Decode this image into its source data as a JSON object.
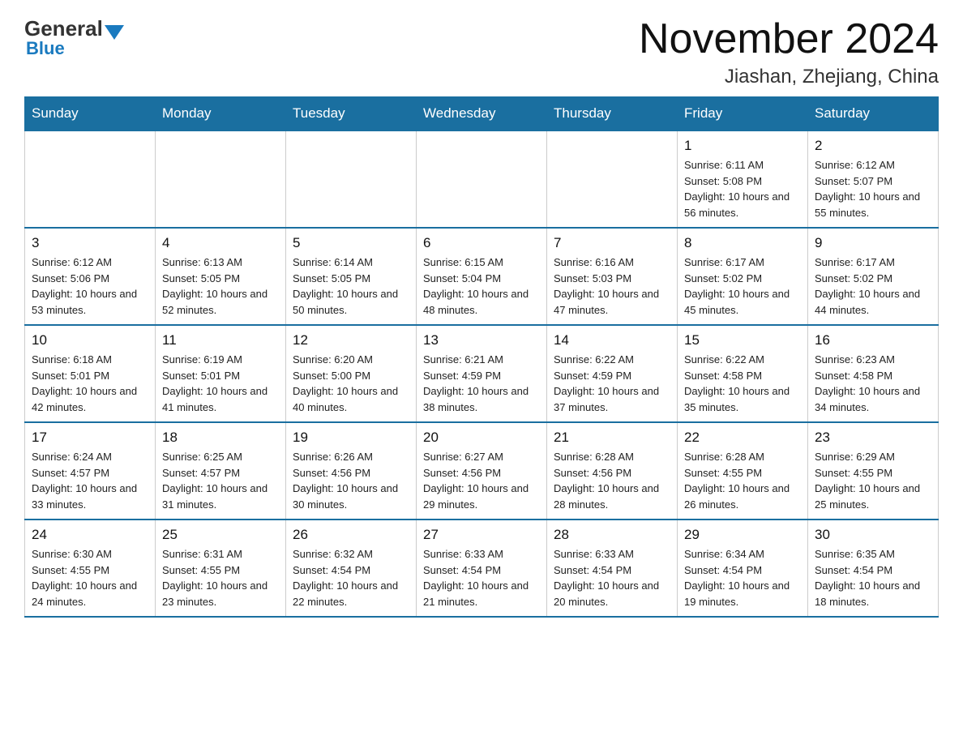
{
  "header": {
    "logo_general": "General",
    "logo_blue": "Blue",
    "month_title": "November 2024",
    "location": "Jiashan, Zhejiang, China"
  },
  "days_of_week": [
    "Sunday",
    "Monday",
    "Tuesday",
    "Wednesday",
    "Thursday",
    "Friday",
    "Saturday"
  ],
  "weeks": [
    [
      {
        "day": "",
        "info": ""
      },
      {
        "day": "",
        "info": ""
      },
      {
        "day": "",
        "info": ""
      },
      {
        "day": "",
        "info": ""
      },
      {
        "day": "",
        "info": ""
      },
      {
        "day": "1",
        "info": "Sunrise: 6:11 AM\nSunset: 5:08 PM\nDaylight: 10 hours and 56 minutes."
      },
      {
        "day": "2",
        "info": "Sunrise: 6:12 AM\nSunset: 5:07 PM\nDaylight: 10 hours and 55 minutes."
      }
    ],
    [
      {
        "day": "3",
        "info": "Sunrise: 6:12 AM\nSunset: 5:06 PM\nDaylight: 10 hours and 53 minutes."
      },
      {
        "day": "4",
        "info": "Sunrise: 6:13 AM\nSunset: 5:05 PM\nDaylight: 10 hours and 52 minutes."
      },
      {
        "day": "5",
        "info": "Sunrise: 6:14 AM\nSunset: 5:05 PM\nDaylight: 10 hours and 50 minutes."
      },
      {
        "day": "6",
        "info": "Sunrise: 6:15 AM\nSunset: 5:04 PM\nDaylight: 10 hours and 48 minutes."
      },
      {
        "day": "7",
        "info": "Sunrise: 6:16 AM\nSunset: 5:03 PM\nDaylight: 10 hours and 47 minutes."
      },
      {
        "day": "8",
        "info": "Sunrise: 6:17 AM\nSunset: 5:02 PM\nDaylight: 10 hours and 45 minutes."
      },
      {
        "day": "9",
        "info": "Sunrise: 6:17 AM\nSunset: 5:02 PM\nDaylight: 10 hours and 44 minutes."
      }
    ],
    [
      {
        "day": "10",
        "info": "Sunrise: 6:18 AM\nSunset: 5:01 PM\nDaylight: 10 hours and 42 minutes."
      },
      {
        "day": "11",
        "info": "Sunrise: 6:19 AM\nSunset: 5:01 PM\nDaylight: 10 hours and 41 minutes."
      },
      {
        "day": "12",
        "info": "Sunrise: 6:20 AM\nSunset: 5:00 PM\nDaylight: 10 hours and 40 minutes."
      },
      {
        "day": "13",
        "info": "Sunrise: 6:21 AM\nSunset: 4:59 PM\nDaylight: 10 hours and 38 minutes."
      },
      {
        "day": "14",
        "info": "Sunrise: 6:22 AM\nSunset: 4:59 PM\nDaylight: 10 hours and 37 minutes."
      },
      {
        "day": "15",
        "info": "Sunrise: 6:22 AM\nSunset: 4:58 PM\nDaylight: 10 hours and 35 minutes."
      },
      {
        "day": "16",
        "info": "Sunrise: 6:23 AM\nSunset: 4:58 PM\nDaylight: 10 hours and 34 minutes."
      }
    ],
    [
      {
        "day": "17",
        "info": "Sunrise: 6:24 AM\nSunset: 4:57 PM\nDaylight: 10 hours and 33 minutes."
      },
      {
        "day": "18",
        "info": "Sunrise: 6:25 AM\nSunset: 4:57 PM\nDaylight: 10 hours and 31 minutes."
      },
      {
        "day": "19",
        "info": "Sunrise: 6:26 AM\nSunset: 4:56 PM\nDaylight: 10 hours and 30 minutes."
      },
      {
        "day": "20",
        "info": "Sunrise: 6:27 AM\nSunset: 4:56 PM\nDaylight: 10 hours and 29 minutes."
      },
      {
        "day": "21",
        "info": "Sunrise: 6:28 AM\nSunset: 4:56 PM\nDaylight: 10 hours and 28 minutes."
      },
      {
        "day": "22",
        "info": "Sunrise: 6:28 AM\nSunset: 4:55 PM\nDaylight: 10 hours and 26 minutes."
      },
      {
        "day": "23",
        "info": "Sunrise: 6:29 AM\nSunset: 4:55 PM\nDaylight: 10 hours and 25 minutes."
      }
    ],
    [
      {
        "day": "24",
        "info": "Sunrise: 6:30 AM\nSunset: 4:55 PM\nDaylight: 10 hours and 24 minutes."
      },
      {
        "day": "25",
        "info": "Sunrise: 6:31 AM\nSunset: 4:55 PM\nDaylight: 10 hours and 23 minutes."
      },
      {
        "day": "26",
        "info": "Sunrise: 6:32 AM\nSunset: 4:54 PM\nDaylight: 10 hours and 22 minutes."
      },
      {
        "day": "27",
        "info": "Sunrise: 6:33 AM\nSunset: 4:54 PM\nDaylight: 10 hours and 21 minutes."
      },
      {
        "day": "28",
        "info": "Sunrise: 6:33 AM\nSunset: 4:54 PM\nDaylight: 10 hours and 20 minutes."
      },
      {
        "day": "29",
        "info": "Sunrise: 6:34 AM\nSunset: 4:54 PM\nDaylight: 10 hours and 19 minutes."
      },
      {
        "day": "30",
        "info": "Sunrise: 6:35 AM\nSunset: 4:54 PM\nDaylight: 10 hours and 18 minutes."
      }
    ]
  ]
}
